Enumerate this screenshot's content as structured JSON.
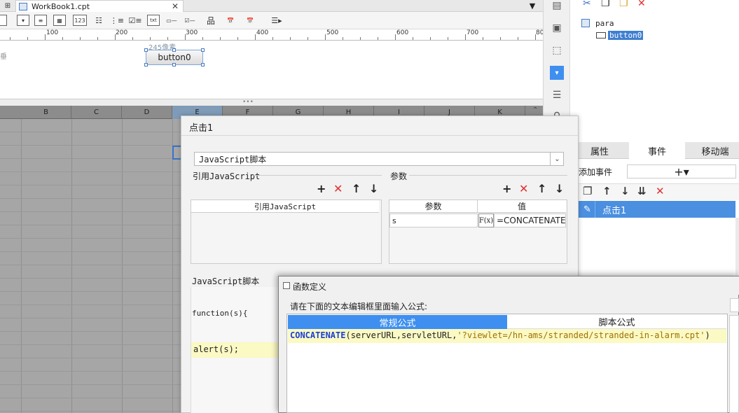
{
  "tab": {
    "title": "WorkBook1.cpt",
    "close": "✕"
  },
  "ruler": {
    "ticks": [
      "100",
      "200",
      "300",
      "400",
      "500",
      "600",
      "700",
      "80"
    ]
  },
  "canvas": {
    "dim_label": "245像素",
    "button_label": "button0",
    "left_cut": "垂"
  },
  "grid": {
    "columns": [
      "B",
      "C",
      "D",
      "E",
      "F",
      "G",
      "H",
      "I",
      "J",
      "K"
    ]
  },
  "tree": {
    "root": "para",
    "child": "button0"
  },
  "props": {
    "tabs": [
      "属性",
      "事件",
      "移动端"
    ],
    "add_event_label": "添加事件",
    "add_event_btn": "+▾",
    "event_item": "点击1"
  },
  "dialog1": {
    "title": "点击1",
    "type_value": "JavaScript脚本",
    "ref_group": "引用JavaScript",
    "param_group": "参数",
    "ref_col": "引用JavaScript",
    "param_cols": {
      "name": "参数",
      "value": "值"
    },
    "param_row": {
      "name": "s",
      "fx": "F(x)",
      "value": "=CONCATENATE"
    },
    "script_label": "JavaScript脚本",
    "code_fn": "function(s){",
    "code_alert": "alert(s);"
  },
  "dialog2": {
    "title": "函数定义",
    "prompt": "请在下面的文本编辑框里面输入公式:",
    "tab_normal": "常规公式",
    "tab_script": "脚本公式",
    "formula_fn": "CONCATENATE",
    "formula_args": "(serverURL,servletURL,",
    "formula_str": "'?viewlet=/hn-ams/stranded/stranded-in-alarm.cpt'",
    "formula_close": ")"
  },
  "colors": {
    "accent": "#3e8ff0",
    "selection": "#4a8fe0",
    "danger": "#e03030",
    "highlight": "#fbf9c4"
  }
}
